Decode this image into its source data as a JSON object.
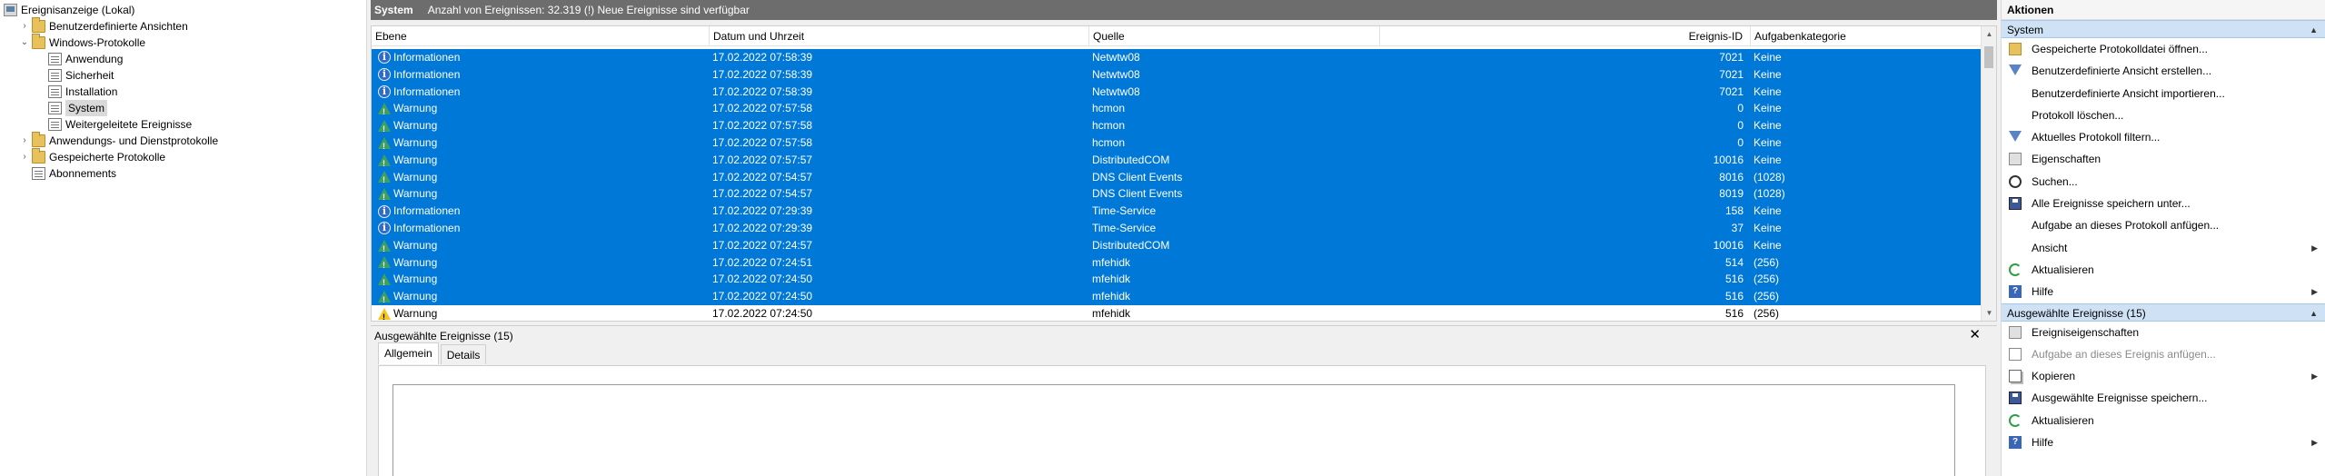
{
  "tree": {
    "items": [
      {
        "label": "Ereignisanzeige (Lokal)",
        "icon": "event-viewer-icon"
      },
      {
        "label": "Benutzerdefinierte Ansichten",
        "icon": "folder-icon",
        "arrow": "›"
      },
      {
        "label": "Windows-Protokolle",
        "icon": "folder-icon",
        "arrow": "⌄"
      },
      {
        "label": "Anwendung",
        "icon": "log-icon"
      },
      {
        "label": "Sicherheit",
        "icon": "log-icon"
      },
      {
        "label": "Installation",
        "icon": "log-icon"
      },
      {
        "label": "System",
        "icon": "log-icon",
        "selected": true
      },
      {
        "label": "Weitergeleitete Ereignisse",
        "icon": "log-icon"
      },
      {
        "label": "Anwendungs- und Dienstprotokolle",
        "icon": "folder-icon",
        "arrow": "›"
      },
      {
        "label": "Gespeicherte Protokolle",
        "icon": "folder-icon",
        "arrow": "›"
      },
      {
        "label": "Abonnements",
        "icon": "log-icon"
      }
    ]
  },
  "header": {
    "title": "System",
    "info": "Anzahl von Ereignissen: 32.319 (!) Neue Ereignisse sind verfügbar"
  },
  "columns": {
    "level": "Ebene",
    "date": "Datum und Uhrzeit",
    "source": "Quelle",
    "id": "Ereignis-ID",
    "category": "Aufgabenkategorie"
  },
  "events": [
    {
      "level": "Informationen",
      "type": "info",
      "date": "17.02.2022 07:58:39",
      "source": "Netwtw08",
      "id": "7021",
      "category": "Keine"
    },
    {
      "level": "Informationen",
      "type": "info",
      "date": "17.02.2022 07:58:39",
      "source": "Netwtw08",
      "id": "7021",
      "category": "Keine"
    },
    {
      "level": "Informationen",
      "type": "info",
      "date": "17.02.2022 07:58:39",
      "source": "Netwtw08",
      "id": "7021",
      "category": "Keine"
    },
    {
      "level": "Warnung",
      "type": "warn",
      "date": "17.02.2022 07:57:58",
      "source": "hcmon",
      "id": "0",
      "category": "Keine"
    },
    {
      "level": "Warnung",
      "type": "warn",
      "date": "17.02.2022 07:57:58",
      "source": "hcmon",
      "id": "0",
      "category": "Keine"
    },
    {
      "level": "Warnung",
      "type": "warn",
      "date": "17.02.2022 07:57:58",
      "source": "hcmon",
      "id": "0",
      "category": "Keine"
    },
    {
      "level": "Warnung",
      "type": "warn",
      "date": "17.02.2022 07:57:57",
      "source": "DistributedCOM",
      "id": "10016",
      "category": "Keine"
    },
    {
      "level": "Warnung",
      "type": "warn",
      "date": "17.02.2022 07:54:57",
      "source": "DNS Client Events",
      "id": "8016",
      "category": "(1028)"
    },
    {
      "level": "Warnung",
      "type": "warn",
      "date": "17.02.2022 07:54:57",
      "source": "DNS Client Events",
      "id": "8019",
      "category": "(1028)"
    },
    {
      "level": "Informationen",
      "type": "info",
      "date": "17.02.2022 07:29:39",
      "source": "Time-Service",
      "id": "158",
      "category": "Keine"
    },
    {
      "level": "Informationen",
      "type": "info",
      "date": "17.02.2022 07:29:39",
      "source": "Time-Service",
      "id": "37",
      "category": "Keine"
    },
    {
      "level": "Warnung",
      "type": "warn",
      "date": "17.02.2022 07:24:57",
      "source": "DistributedCOM",
      "id": "10016",
      "category": "Keine"
    },
    {
      "level": "Warnung",
      "type": "warn",
      "date": "17.02.2022 07:24:51",
      "source": "mfehidk",
      "id": "514",
      "category": "(256)"
    },
    {
      "level": "Warnung",
      "type": "warn",
      "date": "17.02.2022 07:24:50",
      "source": "mfehidk",
      "id": "516",
      "category": "(256)"
    },
    {
      "level": "Warnung",
      "type": "warn",
      "date": "17.02.2022 07:24:50",
      "source": "mfehidk",
      "id": "516",
      "category": "(256)"
    },
    {
      "level": "Warnung",
      "type": "warn",
      "date": "17.02.2022 07:24:50",
      "source": "mfehidk",
      "id": "516",
      "category": "(256)"
    }
  ],
  "detail": {
    "title": "Ausgewählte Ereignisse (15)",
    "close": "✕",
    "tabs": [
      "Allgemein",
      "Details"
    ]
  },
  "actions": {
    "title": "Aktionen",
    "sections": [
      {
        "title": "System",
        "items": [
          {
            "label": "Gespeicherte Protokolldatei öffnen...",
            "icon": "open-icon"
          },
          {
            "label": "Benutzerdefinierte Ansicht erstellen...",
            "icon": "filter-icon"
          },
          {
            "label": "Benutzerdefinierte Ansicht importieren...",
            "icon": ""
          },
          {
            "label": "Protokoll löschen...",
            "icon": ""
          },
          {
            "label": "Aktuelles Protokoll filtern...",
            "icon": "filter-icon"
          },
          {
            "label": "Eigenschaften",
            "icon": "properties-icon"
          },
          {
            "label": "Suchen...",
            "icon": "find-icon"
          },
          {
            "label": "Alle Ereignisse speichern unter...",
            "icon": "save-icon"
          },
          {
            "label": "Aufgabe an dieses Protokoll anfügen...",
            "icon": ""
          },
          {
            "label": "Ansicht",
            "icon": "",
            "submenu": true
          },
          {
            "label": "Aktualisieren",
            "icon": "refresh-icon"
          },
          {
            "label": "Hilfe",
            "icon": "help-icon",
            "submenu": true
          }
        ]
      },
      {
        "title": "Ausgewählte Ereignisse (15)",
        "items": [
          {
            "label": "Ereigniseigenschaften",
            "icon": "properties-icon"
          },
          {
            "label": "Aufgabe an dieses Ereignis anfügen...",
            "icon": "task-icon",
            "disabled": true
          },
          {
            "label": "Kopieren",
            "icon": "copy-icon",
            "submenu": true
          },
          {
            "label": "Ausgewählte Ereignisse speichern...",
            "icon": "save-icon"
          },
          {
            "label": "Aktualisieren",
            "icon": "refresh-icon"
          },
          {
            "label": "Hilfe",
            "icon": "help-icon",
            "submenu": true
          }
        ]
      }
    ]
  },
  "colors": {
    "selection": "#0078d7",
    "header_bar": "#6d6d6d",
    "section_bg": "#cfe2f5"
  }
}
